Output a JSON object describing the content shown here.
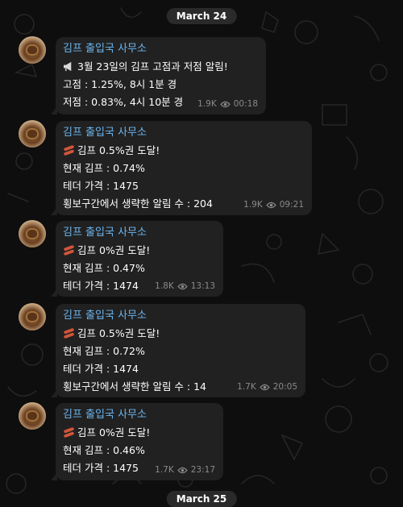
{
  "date_separators": [
    "March 24",
    "March 25"
  ],
  "colors": {
    "background": "#0e0e0e",
    "bubble": "#212121",
    "sender": "#6cb6f0",
    "meta": "#8a8a8a"
  },
  "messages": [
    {
      "sender": "김프 출입국 사무소",
      "icon": "megaphone-icon",
      "lines": [
        "3월 23일의 김프 고점과 저점 알림!",
        "고점 : 1.25%, 8시 1분 경",
        "저점 : 0.83%, 4시 10분 경"
      ],
      "views": "1.9K",
      "time": "00:18"
    },
    {
      "sender": "김프 출입국 사무소",
      "icon": "sausage-icon",
      "lines": [
        "김프 0.5%권 도달!",
        "현재 김프 : 0.74%",
        "테더 가격 : 1475",
        "횡보구간에서 생략한 알림 수 : 204"
      ],
      "views": "1.9K",
      "time": "09:21"
    },
    {
      "sender": "김프 출입국 사무소",
      "icon": "sausage-icon",
      "lines": [
        "김프 0%권 도달!",
        "현재 김프 : 0.47%",
        "테더 가격 : 1474"
      ],
      "views": "1.8K",
      "time": "13:13"
    },
    {
      "sender": "김프 출입국 사무소",
      "icon": "sausage-icon",
      "lines": [
        "김프 0.5%권 도달!",
        "현재 김프 : 0.72%",
        "테더 가격 : 1474",
        "횡보구간에서 생략한 알림 수 : 14"
      ],
      "views": "1.7K",
      "time": "20:05"
    },
    {
      "sender": "김프 출입국 사무소",
      "icon": "sausage-icon",
      "lines": [
        "김프 0%권 도달!",
        "현재 김프 : 0.46%",
        "테더 가격 : 1475"
      ],
      "views": "1.7K",
      "time": "23:17"
    }
  ]
}
